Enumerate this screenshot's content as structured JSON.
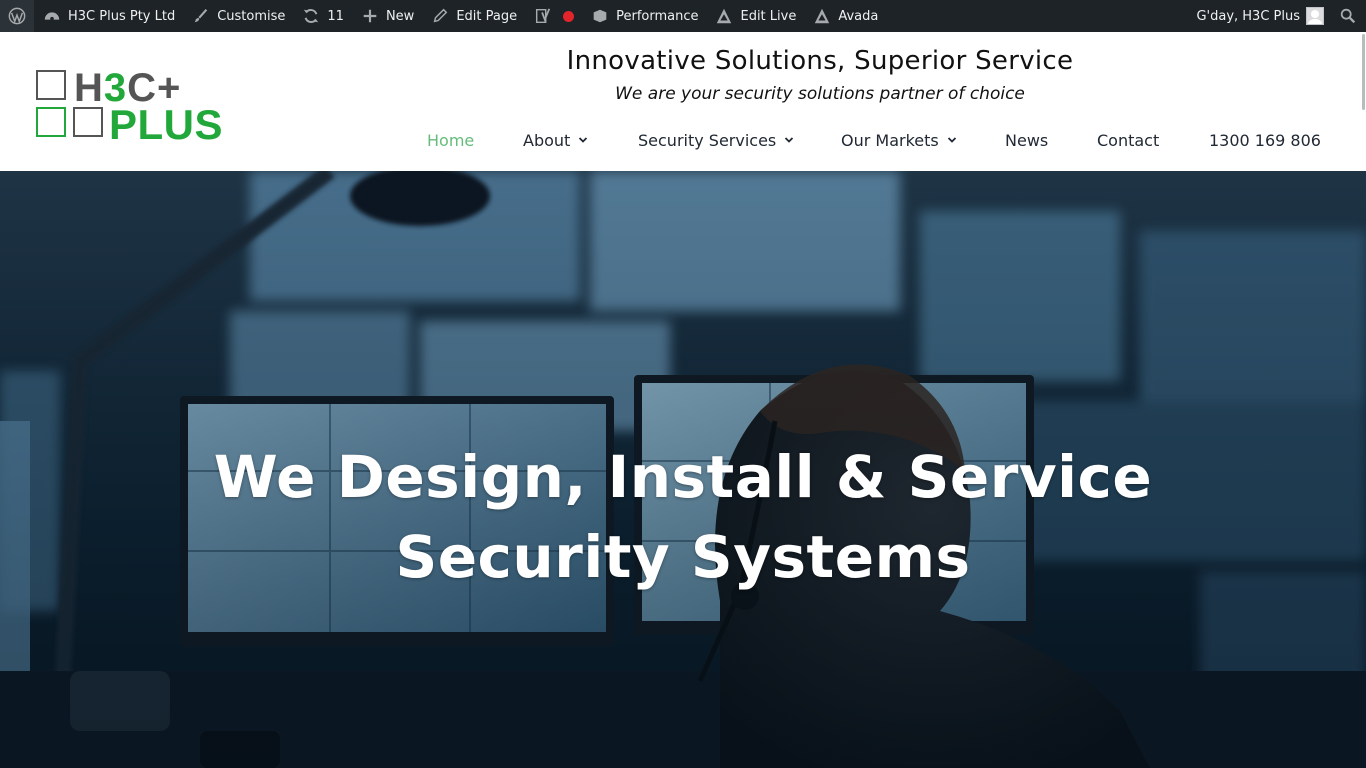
{
  "admin_bar": {
    "site_name": "H3C Plus Pty Ltd",
    "customise": "Customise",
    "updates_count": "11",
    "new": "New",
    "edit_page": "Edit Page",
    "performance": "Performance",
    "edit_live": "Edit Live",
    "avada": "Avada",
    "greeting": "G'day, H3C Plus",
    "recording_color": "#e3242b"
  },
  "header": {
    "logo": {
      "text_top_dark": "H",
      "text_top_green": "3",
      "text_top_dark2": "C+",
      "text_bottom": "PLUS",
      "brand_green": "#22a83a",
      "brand_grey": "#555555"
    },
    "title": "Innovative Solutions, Superior Service",
    "subtitle": "We are your security solutions partner of choice"
  },
  "nav": {
    "active_color": "#65bc7b",
    "items": [
      {
        "label": "Home",
        "active": true
      },
      {
        "label": "About",
        "dropdown": true
      },
      {
        "label": "Security Services",
        "dropdown": true
      },
      {
        "label": "Our Markets",
        "dropdown": true
      },
      {
        "label": "News"
      },
      {
        "label": "Contact"
      },
      {
        "label": "1300 169 806"
      }
    ]
  },
  "hero": {
    "heading_line1": "We Design, Install & Service",
    "heading_line2": "Security Systems"
  }
}
